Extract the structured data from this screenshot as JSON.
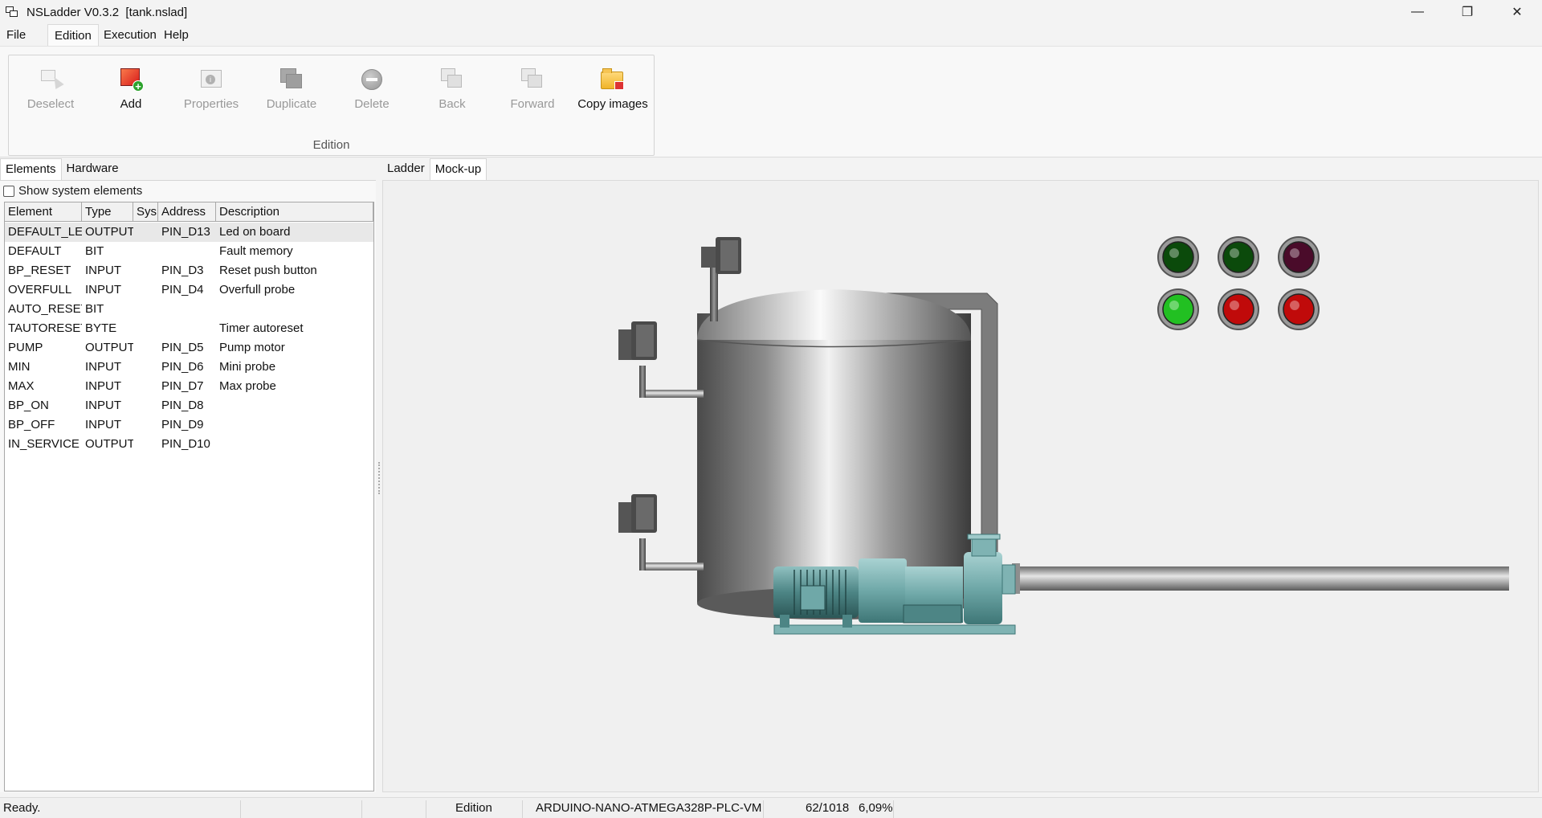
{
  "window": {
    "title": "NSLadder V0.3.2  [tank.nslad]",
    "minimize": "—",
    "maximize": "❐",
    "close": "✕"
  },
  "menu": [
    "File",
    "Edition",
    "Execution",
    "Help"
  ],
  "ribbon": {
    "group_label": "Edition",
    "buttons": [
      {
        "label": "Deselect",
        "icon": "deselect-icon",
        "enabled": false
      },
      {
        "label": "Add",
        "icon": "add-icon",
        "enabled": true
      },
      {
        "label": "Properties",
        "icon": "properties-icon",
        "enabled": false
      },
      {
        "label": "Duplicate",
        "icon": "duplicate-icon",
        "enabled": false
      },
      {
        "label": "Delete",
        "icon": "delete-icon",
        "enabled": false
      },
      {
        "label": "Back",
        "icon": "back-icon",
        "enabled": false
      },
      {
        "label": "Forward",
        "icon": "forward-icon",
        "enabled": false
      },
      {
        "label": "Copy images",
        "icon": "copy-images-icon",
        "enabled": true
      }
    ]
  },
  "left_tabs": [
    "Elements",
    "Hardware"
  ],
  "show_system": "Show system elements",
  "table": {
    "columns": [
      "Element",
      "Type",
      "Sys",
      "Address",
      "Description"
    ],
    "rows": [
      [
        "DEFAULT_LED",
        "OUTPUT",
        "",
        "PIN_D13",
        "Led on board"
      ],
      [
        "DEFAULT",
        "BIT",
        "",
        "",
        "Fault memory"
      ],
      [
        "BP_RESET",
        "INPUT",
        "",
        "PIN_D3",
        "Reset push button"
      ],
      [
        "OVERFULL",
        "INPUT",
        "",
        "PIN_D4",
        "Overfull probe"
      ],
      [
        "AUTO_RESET",
        "BIT",
        "",
        "",
        ""
      ],
      [
        "TAUTORESET",
        "BYTE",
        "",
        "",
        "Timer autoreset"
      ],
      [
        "PUMP",
        "OUTPUT",
        "",
        "PIN_D5",
        "Pump motor"
      ],
      [
        "MIN",
        "INPUT",
        "",
        "PIN_D6",
        "Mini probe"
      ],
      [
        "MAX",
        "INPUT",
        "",
        "PIN_D7",
        "Max probe"
      ],
      [
        "BP_ON",
        "INPUT",
        "",
        "PIN_D8",
        ""
      ],
      [
        "BP_OFF",
        "INPUT",
        "",
        "PIN_D9",
        ""
      ],
      [
        "IN_SERVICE",
        "OUTPUT",
        "",
        "PIN_D10",
        ""
      ]
    ]
  },
  "right_tabs": [
    "Ladder",
    "Mock-up"
  ],
  "mockup": {
    "lights_top": [
      "#0b4a0b",
      "#0b4a0b",
      "#4a0b2a"
    ],
    "lights_bottom": [
      "#22c022",
      "#c00a0a",
      "#c00a0a"
    ]
  },
  "status": {
    "message": "Ready.",
    "mode": "Edition",
    "target": "ARDUINO-NANO-ATMEGA328P-PLC-VM",
    "memory": "62/1018",
    "percent": "6,09%"
  }
}
